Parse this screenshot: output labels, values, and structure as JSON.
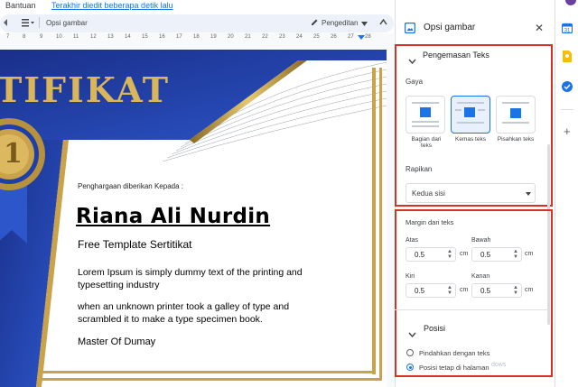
{
  "menu": {
    "help": "Bantuan",
    "last_edit": "Terakhir diedit beberapa detik lalu"
  },
  "toolbar": {
    "zoom_icon": "chevron-down",
    "image_options": "Opsi gambar",
    "mode": "Pengeditan"
  },
  "ruler": {
    "marks": [
      "7",
      "8",
      "9",
      "10",
      "11",
      "12",
      "13",
      "14",
      "15",
      "16",
      "17",
      "18",
      "19",
      "20",
      "21",
      "22",
      "23",
      "24",
      "25",
      "26",
      "27",
      "28"
    ]
  },
  "certificate": {
    "title_part": "TIFIKAT",
    "medal_number": "1",
    "award_line": "Penghargaan diberikan Kepada :",
    "name": "Riana Ali Nurdin",
    "subtitle": "Free Template Sertitikat",
    "body1": "Lorem Ipsum is simply dummy text of the printing and typesetting industry",
    "body2": "when an unknown printer took a galley of type and scrambled it to make a type specimen book.",
    "signature": "Master Of Dumay",
    "colors": {
      "blue": "#1f3fa8",
      "gold": "#c9a24a"
    }
  },
  "panel": {
    "title": "Opsi gambar",
    "text_wrap": {
      "heading": "Pengemasan Teks",
      "style_label": "Gaya",
      "options": [
        "Bagian dari teks",
        "Kemas teks",
        "Pisahkan teks"
      ],
      "selected": "Kemas teks",
      "align_label": "Rapikan",
      "align_value": "Kedua sisi"
    },
    "margins": {
      "heading": "Margin dari teks",
      "top_label": "Atas",
      "top_value": "0.5",
      "bottom_label": "Bawah",
      "bottom_value": "0.5",
      "left_label": "Kiri",
      "left_value": "0.5",
      "right_label": "Kanan",
      "right_value": "0.5",
      "unit": "cm"
    },
    "position": {
      "heading": "Posisi",
      "option1": "Pindahkan dengan teks",
      "option2": "Posisi tetap di halaman",
      "selected": "Posisi tetap di halaman"
    },
    "watermark": "dows"
  },
  "accent": "#1a73e8",
  "highlight": "#d93025"
}
